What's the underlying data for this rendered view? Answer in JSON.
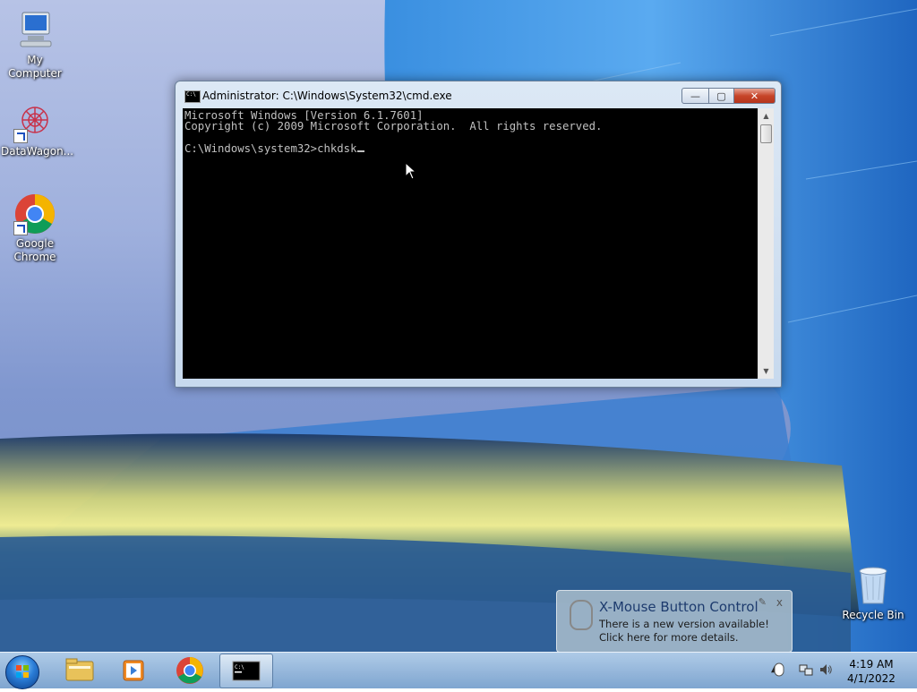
{
  "desktop": {
    "icons": [
      {
        "label": "My Computer"
      },
      {
        "label": "DataWagon..."
      },
      {
        "label": "Google Chrome"
      }
    ],
    "recycle_bin": {
      "label": "Recycle Bin"
    }
  },
  "cmd_window": {
    "title": "Administrator: C:\\Windows\\System32\\cmd.exe",
    "icon_text": "C:\\",
    "lines": [
      "Microsoft Windows [Version 6.1.7601]",
      "Copyright (c) 2009 Microsoft Corporation.  All rights reserved.",
      "",
      "C:\\Windows\\system32>chkdsk"
    ],
    "buttons": {
      "minimize": "—",
      "maximize": "▢",
      "close": "✕"
    }
  },
  "notification": {
    "title": "X-Mouse Button Control",
    "line1": "There is a new version available!",
    "line2": "Click here for more details.",
    "close": "x"
  },
  "taskbar": {
    "pinned": [
      "Windows Explorer",
      "Windows Media Player",
      "Google Chrome",
      "Command Prompt"
    ],
    "active": "Command Prompt",
    "clock_time": "4:19 AM",
    "clock_date": "4/1/2022",
    "show_hidden": "▲"
  },
  "colors": {
    "console_bg": "#000000",
    "console_text": "#c0c0c0",
    "close_red": "#c7452a"
  }
}
